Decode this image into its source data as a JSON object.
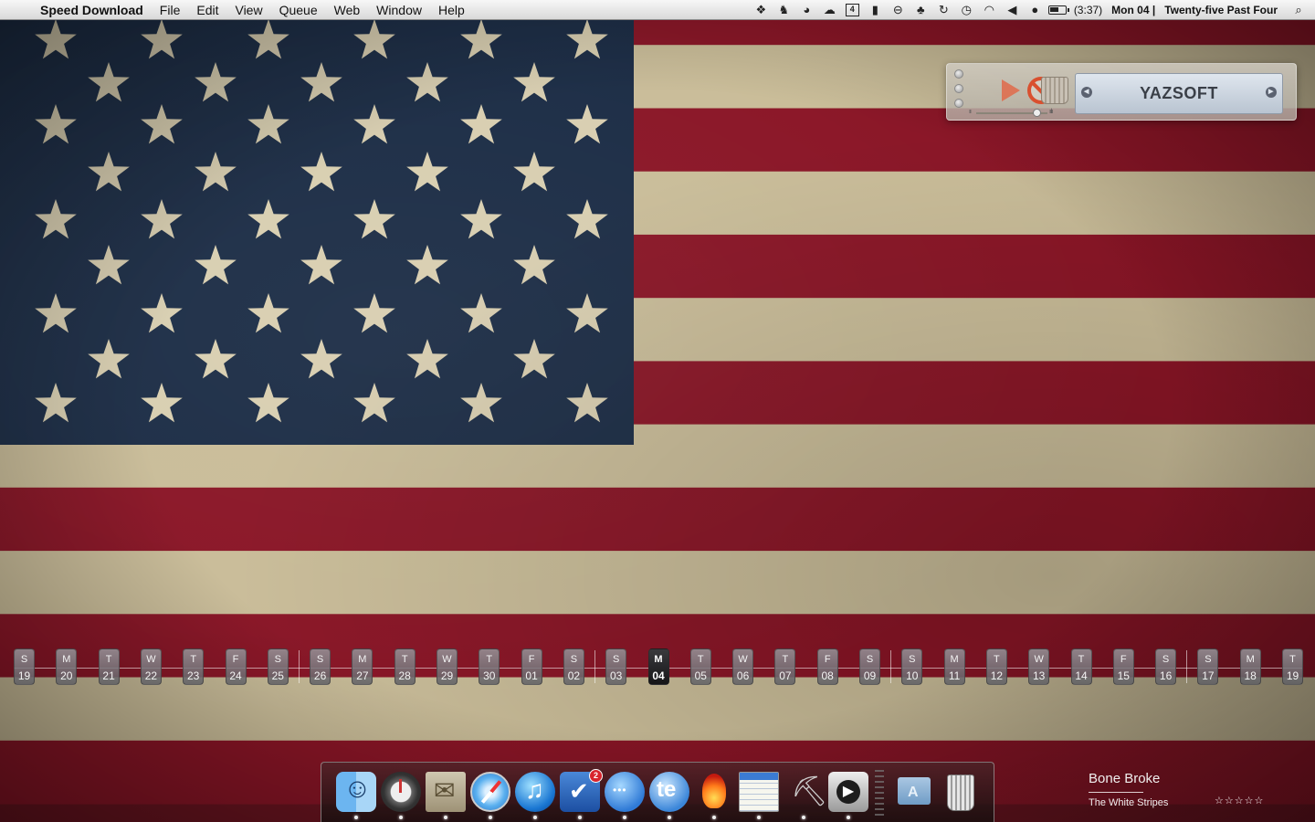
{
  "menubar": {
    "apple_symbol": "",
    "app_name": "Speed Download",
    "menus": [
      "File",
      "Edit",
      "View",
      "Queue",
      "Web",
      "Window",
      "Help"
    ],
    "status_icons": [
      "dropbox-icon",
      "evernote-icon",
      "timer-icon",
      "cloud-icon",
      "workspace-4-icon",
      "bookmark-icon",
      "lock-icon",
      "broom-icon",
      "sync-icon",
      "time-machine-icon",
      "wifi-icon",
      "volume-icon",
      "user-icon",
      "battery-icon"
    ],
    "workspace_number": "4",
    "battery_time": "(3:37)",
    "date": "Mon 04 |",
    "time_words": "Twenty-five Past Four"
  },
  "speed_download_widget": {
    "display_text": "YAZSOFT",
    "speed_slider_level": 0.85,
    "slow_icon": "ıı",
    "fast_icon": "ıılı"
  },
  "calendar_strip": {
    "days": [
      {
        "letter": "S",
        "num": "19"
      },
      {
        "letter": "M",
        "num": "20"
      },
      {
        "letter": "T",
        "num": "21"
      },
      {
        "letter": "W",
        "num": "22"
      },
      {
        "letter": "T",
        "num": "23"
      },
      {
        "letter": "F",
        "num": "24"
      },
      {
        "letter": "S",
        "num": "25"
      },
      {
        "letter": "S",
        "num": "26"
      },
      {
        "letter": "M",
        "num": "27"
      },
      {
        "letter": "T",
        "num": "28"
      },
      {
        "letter": "W",
        "num": "29"
      },
      {
        "letter": "T",
        "num": "30"
      },
      {
        "letter": "F",
        "num": "01"
      },
      {
        "letter": "S",
        "num": "02"
      },
      {
        "letter": "S",
        "num": "03"
      },
      {
        "letter": "M",
        "num": "04"
      },
      {
        "letter": "T",
        "num": "05"
      },
      {
        "letter": "W",
        "num": "06"
      },
      {
        "letter": "T",
        "num": "07"
      },
      {
        "letter": "F",
        "num": "08"
      },
      {
        "letter": "S",
        "num": "09"
      },
      {
        "letter": "S",
        "num": "10"
      },
      {
        "letter": "M",
        "num": "11"
      },
      {
        "letter": "T",
        "num": "12"
      },
      {
        "letter": "W",
        "num": "13"
      },
      {
        "letter": "T",
        "num": "14"
      },
      {
        "letter": "F",
        "num": "15"
      },
      {
        "letter": "S",
        "num": "16"
      },
      {
        "letter": "S",
        "num": "17"
      },
      {
        "letter": "M",
        "num": "18"
      },
      {
        "letter": "T",
        "num": "19"
      }
    ],
    "today_index": 15
  },
  "dock": {
    "apps": [
      {
        "name": "finder-icon",
        "running": true
      },
      {
        "name": "timemachine-icon",
        "running": true
      },
      {
        "name": "mail-icon",
        "running": true
      },
      {
        "name": "safari-icon",
        "running": true
      },
      {
        "name": "itunes-icon",
        "running": true
      },
      {
        "name": "things-icon",
        "running": true,
        "badge": "2"
      },
      {
        "name": "ichat-icon",
        "running": true
      },
      {
        "name": "textexpander-icon",
        "running": true
      },
      {
        "name": "speeddownload-icon",
        "running": true
      },
      {
        "name": "textedit-icon",
        "running": true
      },
      {
        "name": "instruments-icon",
        "running": true
      },
      {
        "name": "quicktime-icon",
        "running": true
      }
    ],
    "stacks": [
      {
        "name": "applications-icon"
      },
      {
        "name": "trash-icon"
      }
    ]
  },
  "now_playing": {
    "title": "Bone Broke",
    "artist": "The White Stripes",
    "rating_stars": "☆☆☆☆☆"
  },
  "colors": {
    "flag_red": "#8a1526",
    "flag_white": "#c9bc98",
    "flag_blue": "#1b2c45",
    "star": "#d8ceb0"
  }
}
